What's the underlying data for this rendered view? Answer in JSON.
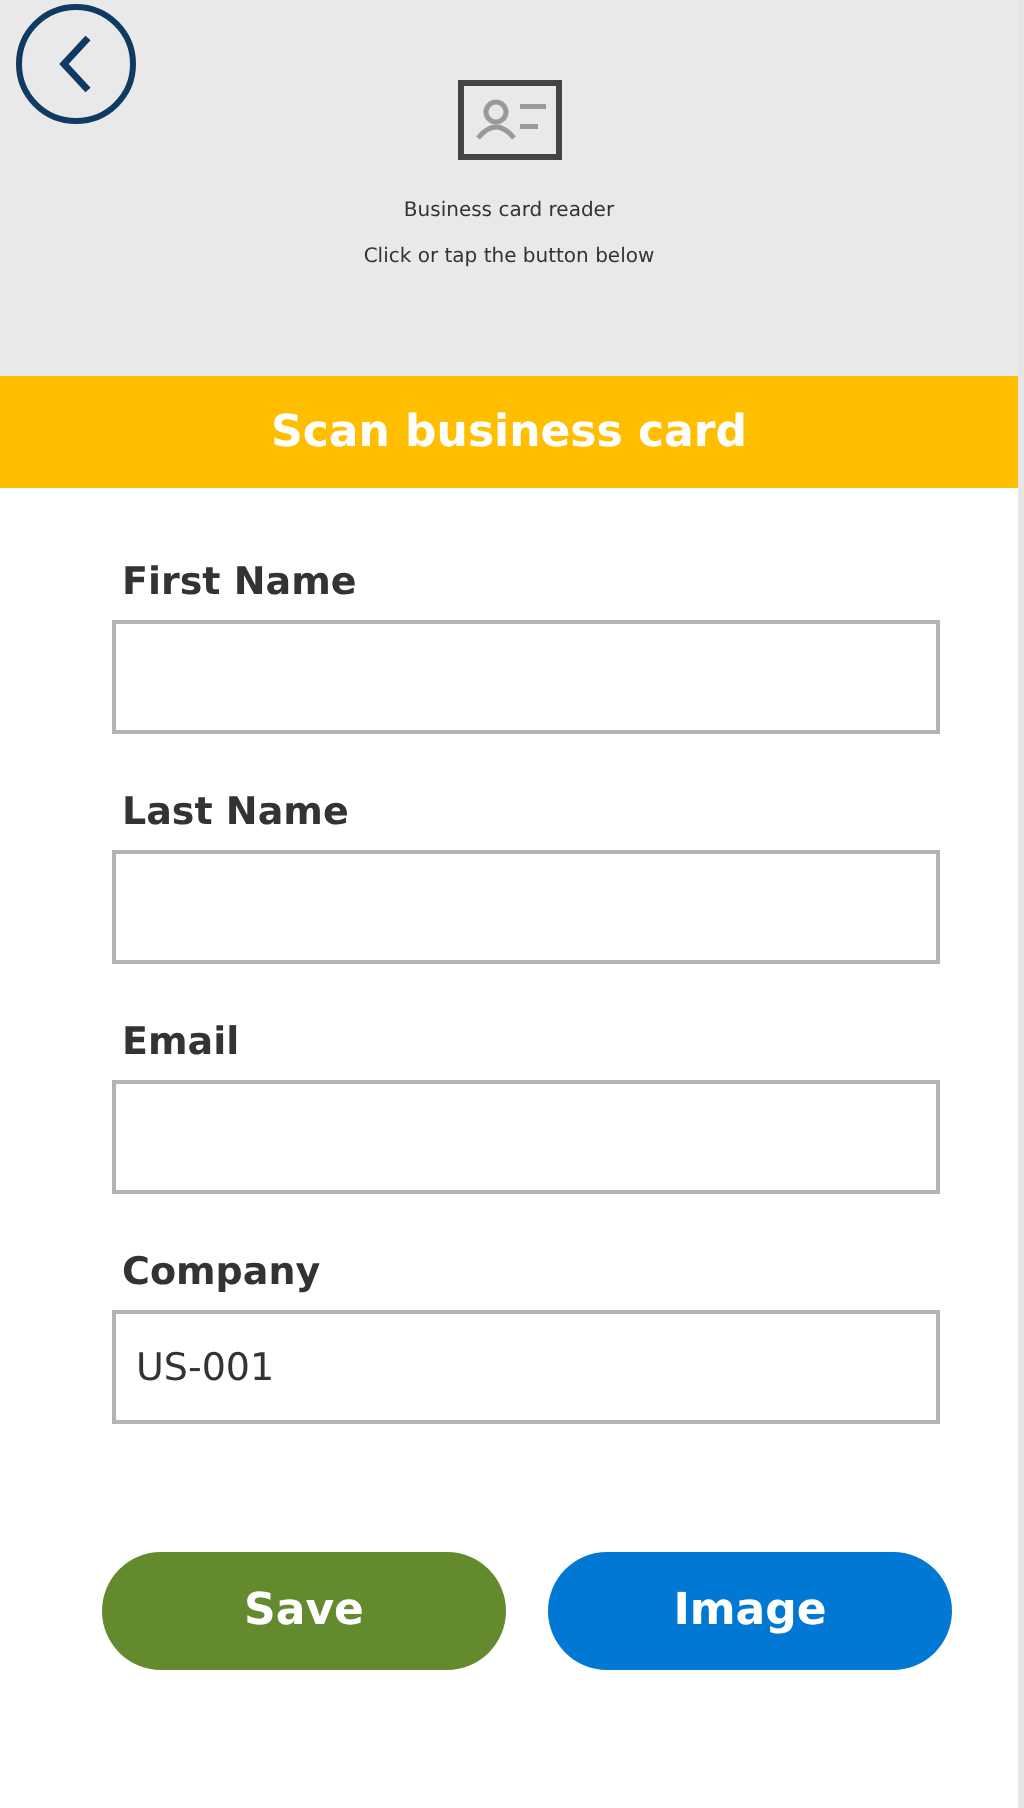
{
  "header": {
    "title": "Business card reader",
    "subtitle": "Click or tap the button below"
  },
  "scan_button": "Scan business card",
  "fields": [
    {
      "label": "First Name"
    },
    {
      "label": "Last Name"
    },
    {
      "label": "Email"
    },
    {
      "label": "Company",
      "value": "US-001"
    }
  ],
  "buttons": [
    {
      "label": "Save",
      "kind": "save"
    },
    {
      "label": "Image",
      "kind": "image"
    }
  ]
}
